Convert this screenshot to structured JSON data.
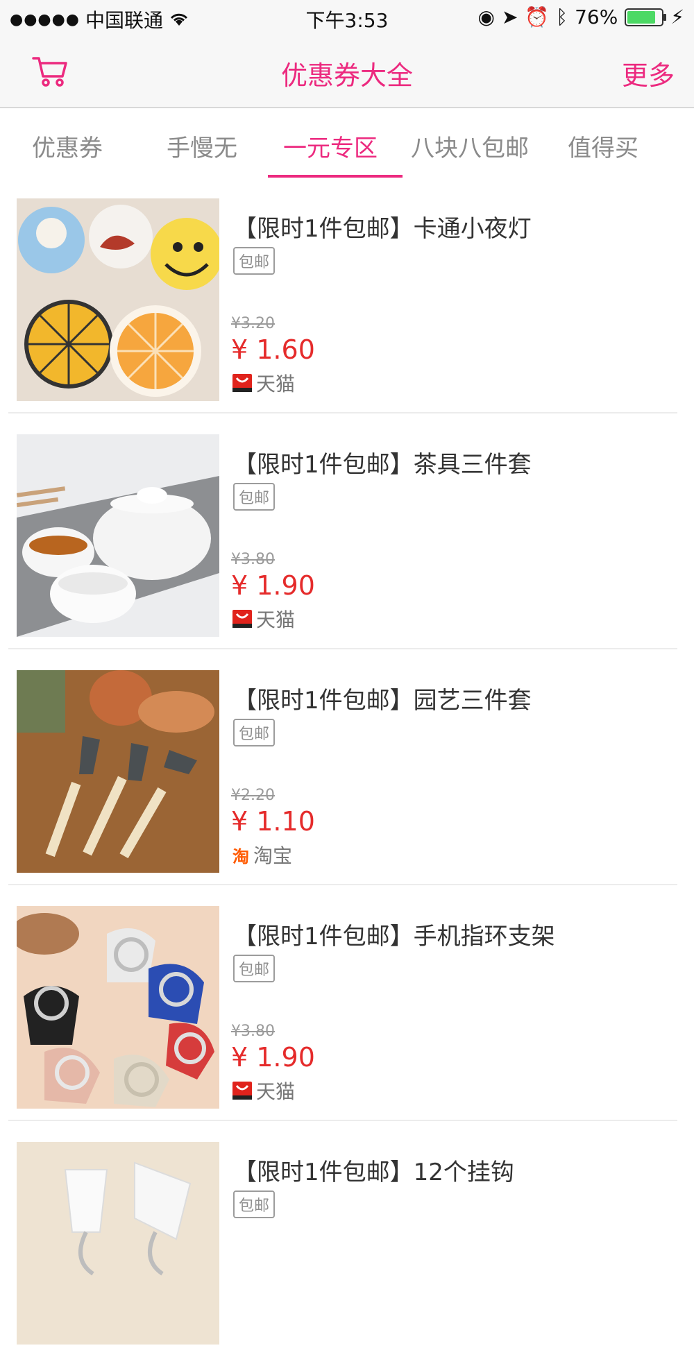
{
  "status": {
    "carrier": "中国联通",
    "time": "下午3:53",
    "battery": "76%"
  },
  "header": {
    "title": "优惠券大全",
    "more": "更多"
  },
  "tabs": [
    {
      "label": "优惠券"
    },
    {
      "label": "手慢无"
    },
    {
      "label": "一元专区"
    },
    {
      "label": "八块八包邮"
    },
    {
      "label": "值得买"
    }
  ],
  "items": [
    {
      "title": "【限时1件包邮】卡通小夜灯",
      "tag": "包邮",
      "orig": "¥3.20",
      "price": "¥ 1.60",
      "platform": "天猫"
    },
    {
      "title": "【限时1件包邮】茶具三件套",
      "tag": "包邮",
      "orig": "¥3.80",
      "price": "¥ 1.90",
      "platform": "天猫"
    },
    {
      "title": "【限时1件包邮】园艺三件套",
      "tag": "包邮",
      "orig": "¥2.20",
      "price": "¥ 1.10",
      "platform": "淘宝"
    },
    {
      "title": "【限时1件包邮】手机指环支架",
      "tag": "包邮",
      "orig": "¥3.80",
      "price": "¥ 1.90",
      "platform": "天猫"
    },
    {
      "title": "【限时1件包邮】12个挂钩",
      "tag": "包邮"
    }
  ],
  "colors": {
    "accent": "#ec2a7f",
    "price": "#e52b2b"
  }
}
